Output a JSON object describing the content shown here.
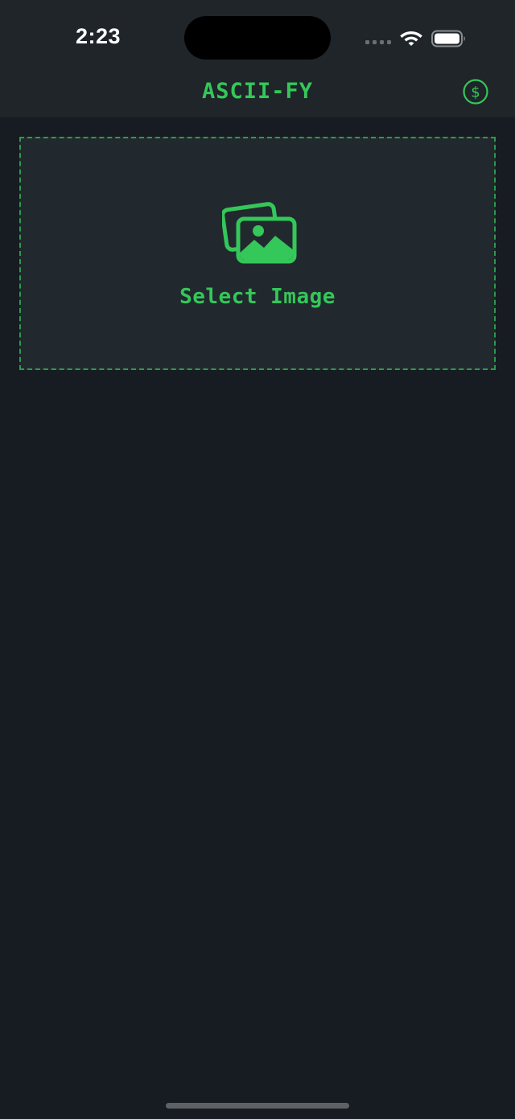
{
  "status_bar": {
    "time": "2:23"
  },
  "nav": {
    "title": "ASCII-FY",
    "right_icon": "dollar-circle-icon"
  },
  "select_panel": {
    "icon": "photo-stack-icon",
    "label": "Select Image"
  },
  "colors": {
    "accent": "#34c759",
    "background": "#161c21",
    "bar_background": "#1f2529",
    "panel_background": "#22292e",
    "dashed_border": "#2e9a4f"
  }
}
